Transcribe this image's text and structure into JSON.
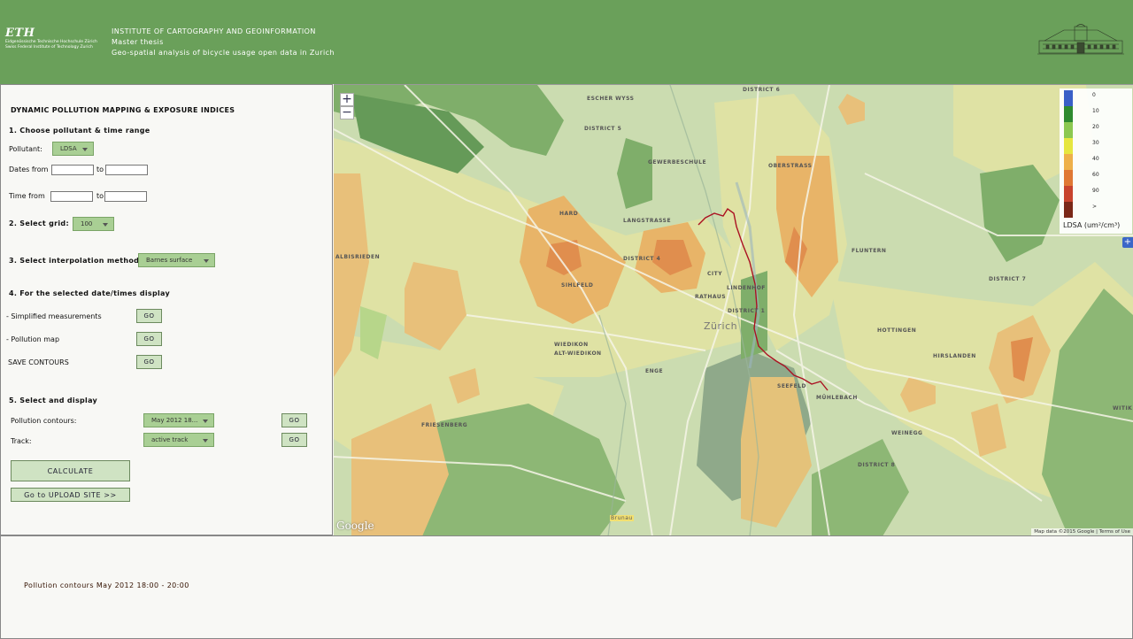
{
  "header": {
    "eth": "ETH",
    "eth_line1": "Eidgenössische Technische Hochschule Zürich",
    "eth_line2": "Swiss Federal Institute of Technology Zurich",
    "institute": "INSTITUTE OF CARTOGRAPHY AND GEOINFORMATION",
    "subtitle": "Master thesis",
    "thesis": "Geo-spatial analysis of bicycle usage open data in Zurich"
  },
  "panel": {
    "title": "DYNAMIC POLLUTION MAPPING & EXPOSURE INDICES",
    "step1": "1. Choose pollutant & time range",
    "pollutant_label": "Pollutant:",
    "pollutant_value": "LDSA",
    "dates_from": "Dates from",
    "to": "to",
    "time_from": "Time from",
    "step2": "2. Select grid:",
    "grid_value": "100",
    "step3": "3. Select interpolation method:",
    "method_value": "Barnes surface",
    "step4": "4. For the selected date/times display",
    "simplified": "- Simplified measurements",
    "pollution_map": "- Pollution map",
    "save_contours": "SAVE CONTOURS",
    "go": "GO",
    "step5": "5. Select and display",
    "pollution_contours": "Pollution contours:",
    "contours_value": "May 2012 18...",
    "track": "Track:",
    "track_value": "active track",
    "calculate": "CALCULATE",
    "upload": "Go to UPLOAD SITE >>"
  },
  "map": {
    "zoom_in": "+",
    "zoom_out": "−",
    "legend_ticks": [
      "0",
      "10",
      "20",
      "30",
      "40",
      "60",
      "90",
      ">"
    ],
    "legend_colors": [
      "#3a5fc7",
      "#2f8a2f",
      "#8cc850",
      "#e6e640",
      "#eeb04a",
      "#e07834",
      "#c8442e",
      "#7a2818"
    ],
    "legend_title": "LDSA (um²/cm³)",
    "labels": [
      "ESCHER WYSS",
      "DISTRICT 5",
      "GEWERBESCHULE",
      "DISTRICT 6",
      "OBERSTRASS",
      "HARD",
      "LANGSTRASSE",
      "ALBISRIEDEN",
      "DISTRICT 4",
      "SIHLFELD",
      "CITY",
      "LINDENHOF",
      "RATHAUS",
      "DISTRICT 1",
      "FLUNTERN",
      "DISTRICT 7",
      "WIEDIKON",
      "ALT-WIEDIKON",
      "Zürich",
      "HOTTINGEN",
      "HIRSLANDEN",
      "ENGE",
      "SEEFELD",
      "MÜHLEBACH",
      "FRIESENBERG",
      "WEINEGG",
      "DISTRICT 8",
      "Brunau",
      "WITIK"
    ],
    "google": "Google",
    "map_data": "Map data ©2015 Google",
    "terms": "Terms of Use"
  },
  "status": "Pollution contours May 2012 18:00 - 20:00"
}
